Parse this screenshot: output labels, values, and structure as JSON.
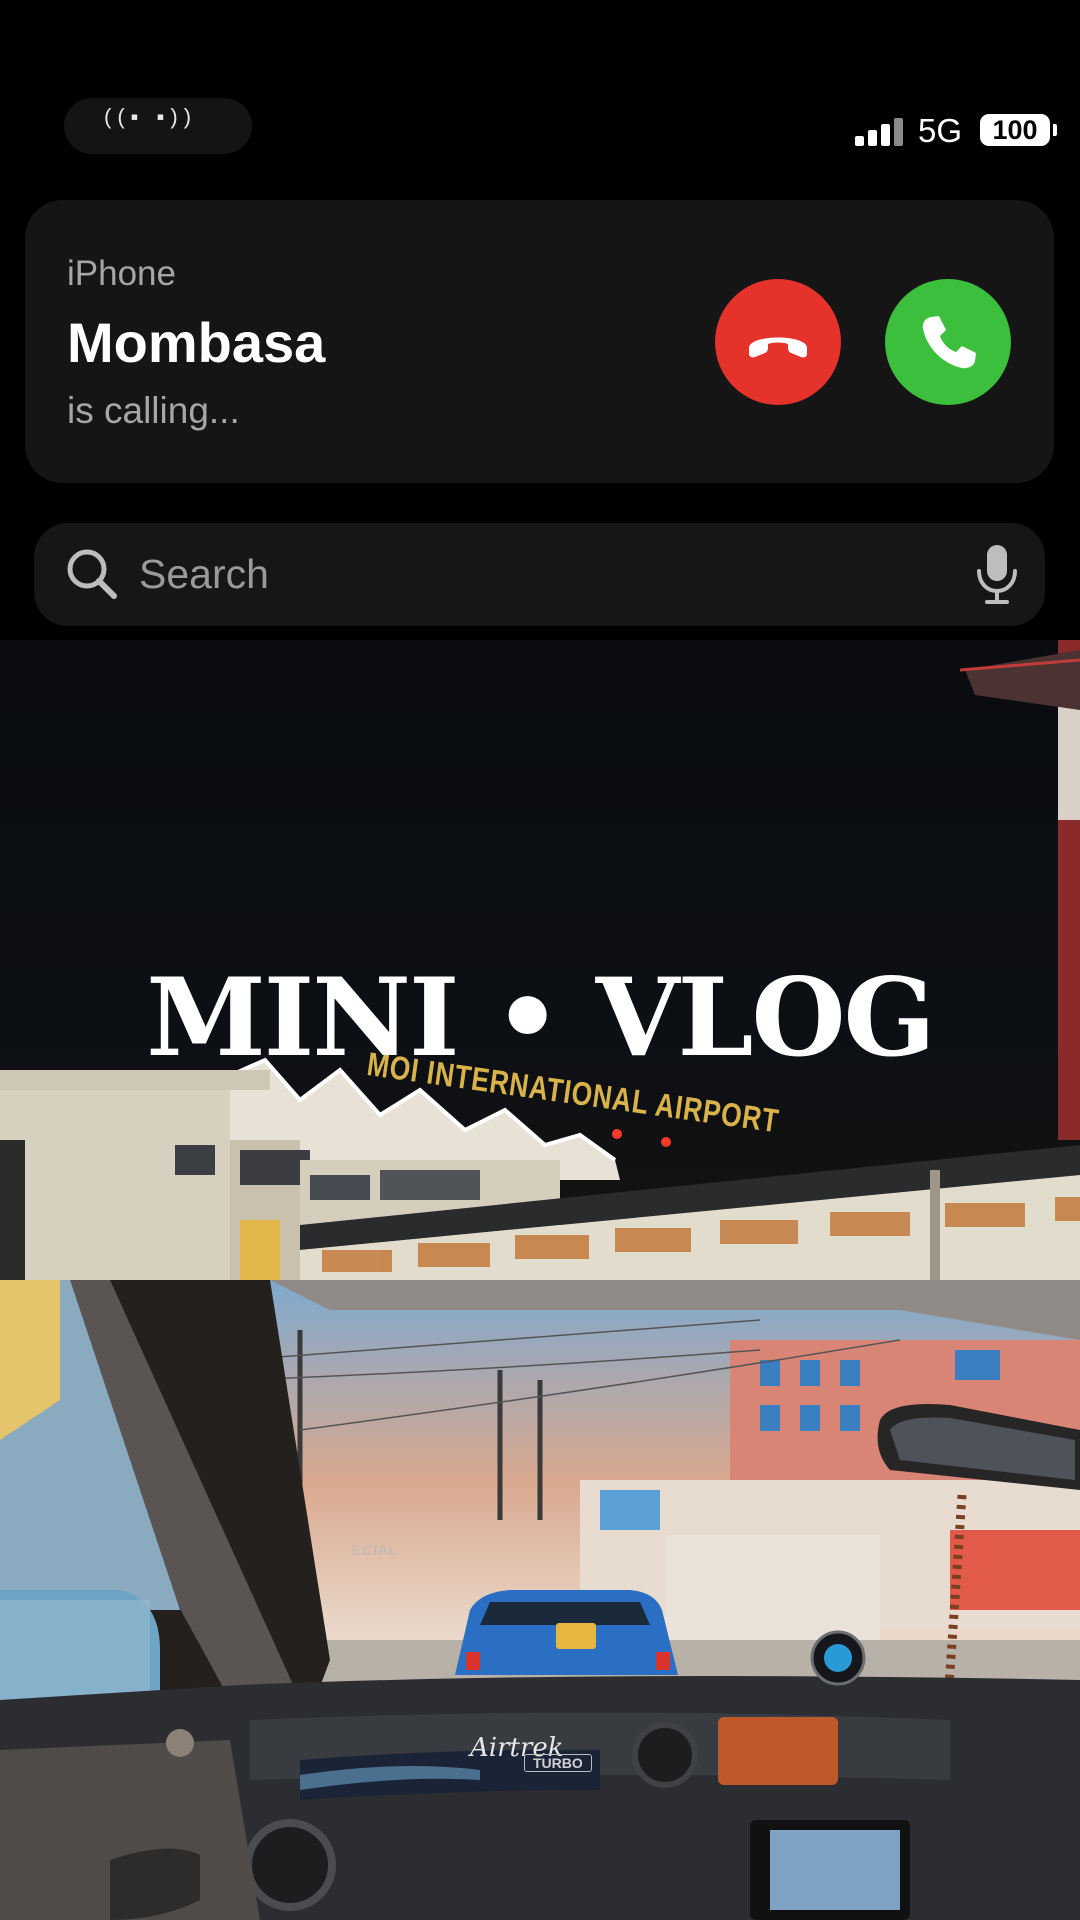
{
  "status_bar": {
    "network": "5G",
    "battery": "100",
    "signal_bars": 4
  },
  "incoming_call": {
    "source": "iPhone",
    "caller": "Mombasa",
    "status": "is calling...",
    "decline_color": "#e5322b",
    "accept_color": "#3cbf3c"
  },
  "search": {
    "placeholder": "Search"
  },
  "video": {
    "title": "MINI • VLOG",
    "airport_sign": "MOI INTERNATIONAL AIRPORT",
    "dash_logo": "Airtrek",
    "dash_badge": "TURBO",
    "shop_sign": "ECIAL"
  },
  "icons": {
    "decline": "phone-hangup-icon",
    "accept": "phone-icon",
    "search": "search-icon",
    "mic": "mic-icon"
  }
}
